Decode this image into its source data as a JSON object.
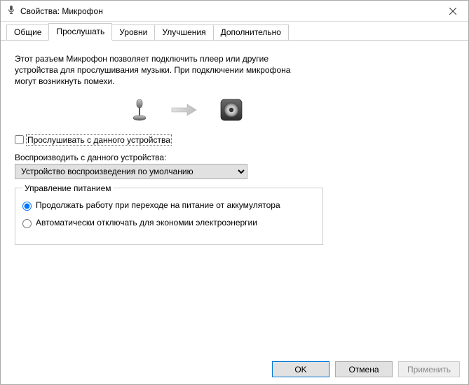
{
  "window": {
    "title": "Свойства: Микрофон"
  },
  "tabs": [
    {
      "label": "Общие"
    },
    {
      "label": "Прослушать"
    },
    {
      "label": "Уровни"
    },
    {
      "label": "Улучшения"
    },
    {
      "label": "Дополнительно"
    }
  ],
  "activeTabIndex": 1,
  "listenTab": {
    "description": "Этот разъем Микрофон позволяет подключить плеер или другие устройства для прослушивания музыки. При подключении микрофона могут возникнуть помехи.",
    "listenCheckbox": {
      "label": "Прослушивать с данного устройства",
      "checked": false
    },
    "playbackLabel": "Воспроизводить с данного устройства:",
    "playbackSelected": "Устройство воспроизведения по умолчанию",
    "powerGroup": {
      "legend": "Управление питанием",
      "options": [
        {
          "label": "Продолжать работу при переходе на питание от аккумулятора",
          "selected": true
        },
        {
          "label": "Автоматически отключать для экономии электроэнергии",
          "selected": false
        }
      ]
    }
  },
  "buttons": {
    "ok": "OK",
    "cancel": "Отмена",
    "apply": "Применить"
  }
}
